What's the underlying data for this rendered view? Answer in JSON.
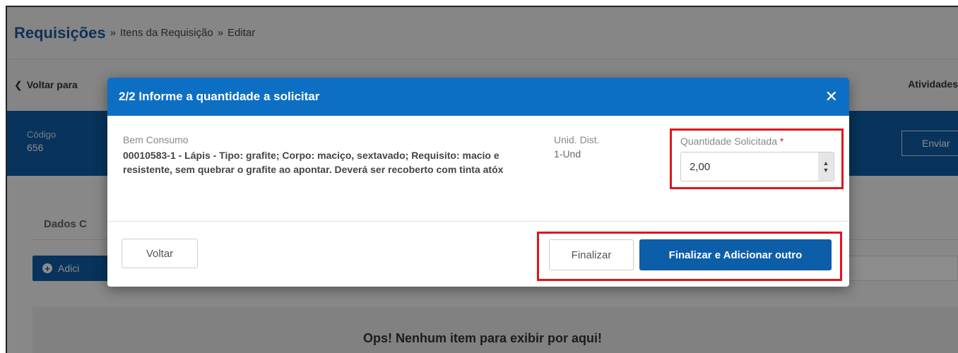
{
  "page": {
    "title": "Requisições",
    "breadcrumb_sep1": "»",
    "breadcrumb_1": "Itens da Requisição",
    "breadcrumb_sep2": "»",
    "breadcrumb_2": "Editar",
    "back_link": "Voltar para",
    "activities": "Atividades",
    "code_label": "Código",
    "code_value": "656",
    "send_button": "Enviar",
    "tab_dados": "Dados C",
    "add_button": "Adici",
    "empty_message": "Ops! Nenhum item para exibir por aqui!"
  },
  "modal": {
    "title": "2/2 Informe a quantidade a solicitar",
    "close": "✕",
    "item_label": "Bem Consumo",
    "item_description": "00010583-1 - Lápis - Tipo: grafite; Corpo: maciço, sextavado; Requisito: macio e resistente, sem quebrar o grafite ao apontar. Deverá ser recoberto com tinta atóx",
    "unit_label": "Unid. Dist.",
    "unit_value": "1-Und",
    "quantity_label": "Quantidade Solicitada",
    "required_mark": "*",
    "quantity_value": "2,00",
    "back_button": "Voltar",
    "finalize_button": "Finalizar",
    "finalize_add_button": "Finalizar e Adicionar outro"
  },
  "colors": {
    "primary": "#0d5ea8",
    "header_blue": "#0d6fc4",
    "highlight_red": "#e0141e"
  }
}
